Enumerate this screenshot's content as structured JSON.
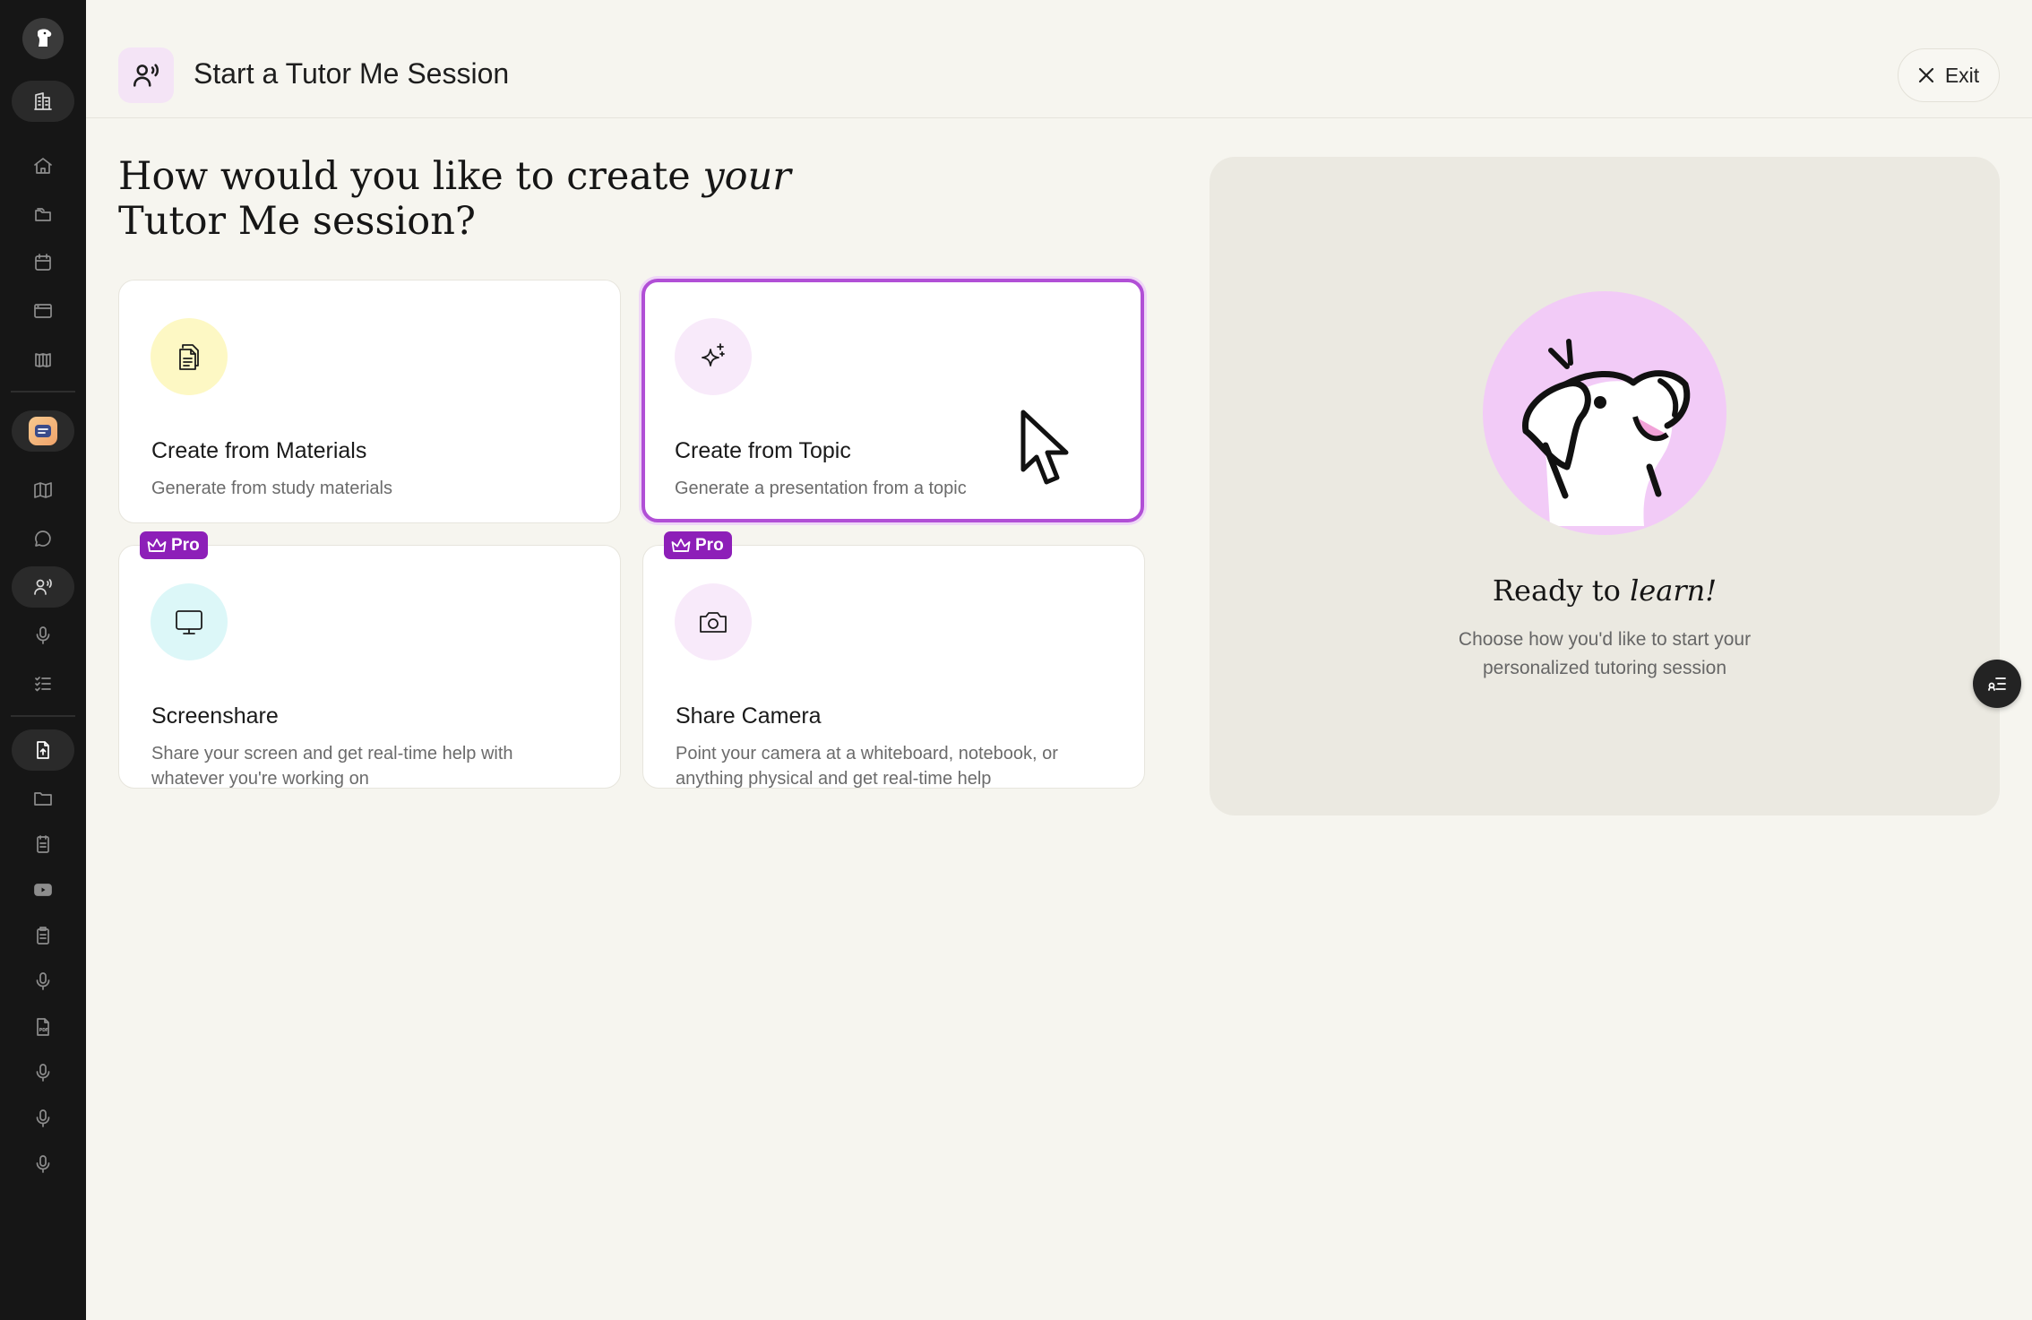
{
  "header": {
    "title": "Start a Tutor Me Session",
    "icon": "tutor-voice-icon",
    "exit_label": "Exit"
  },
  "heading": {
    "prefix": "How would you like to create ",
    "emphasis": "your",
    "suffix": " Tutor Me session?"
  },
  "options": [
    {
      "title": "Create from Materials",
      "description": "Generate from study materials",
      "icon": "documents-icon",
      "icon_bg": "#fdf8c4",
      "pro": false,
      "selected": false
    },
    {
      "title": "Create from Topic",
      "description": "Generate a presentation from a topic",
      "icon": "sparkles-icon",
      "icon_bg": "#f8eafa",
      "pro": false,
      "selected": true
    },
    {
      "title": "Screenshare",
      "description": "Share your screen and get real-time help with whatever you're working on",
      "icon": "monitor-icon",
      "icon_bg": "#dcf7f8",
      "pro": true,
      "selected": false
    },
    {
      "title": "Share Camera",
      "description": "Point your camera at a whiteboard, notebook, or anything physical and get real-time help",
      "icon": "camera-icon",
      "icon_bg": "#f8eafa",
      "pro": true,
      "selected": false
    }
  ],
  "pro_badge": "Pro",
  "panel": {
    "title_prefix": "Ready to ",
    "title_emphasis": "learn!",
    "subtitle": "Choose how you'd like to start your personalized tutoring session"
  },
  "colors": {
    "accent": "#b14fd6",
    "pro_badge": "#8d1fb8",
    "sidebar_bg": "#161616",
    "page_bg": "#f6f5ef",
    "panel_bg": "#ebe9e1",
    "mascot_bg": "#f2cbf7"
  },
  "sidebar": {
    "items": [
      {
        "icon": "building-icon",
        "active": true
      },
      {
        "icon": "home-icon",
        "active": false
      },
      {
        "icon": "folders-icon",
        "active": false
      },
      {
        "icon": "calendar-icon",
        "active": false
      },
      {
        "icon": "browser-window-icon",
        "active": false
      },
      {
        "icon": "library-icon",
        "active": false
      },
      {
        "icon": "app-badge-icon",
        "active": true
      },
      {
        "icon": "map-icon",
        "active": false
      },
      {
        "icon": "chat-bubble-icon",
        "active": false
      },
      {
        "icon": "tutor-voice-icon",
        "active": true
      },
      {
        "icon": "microphone-icon",
        "active": false
      },
      {
        "icon": "checklist-icon",
        "active": false
      },
      {
        "icon": "file-upload-icon",
        "active": true
      },
      {
        "icon": "folder-icon",
        "active": false
      },
      {
        "icon": "notes-icon",
        "active": false
      },
      {
        "icon": "youtube-icon",
        "active": false
      },
      {
        "icon": "clipboard-icon",
        "active": false
      },
      {
        "icon": "microphone-icon",
        "active": false
      },
      {
        "icon": "pdf-file-icon",
        "active": false
      },
      {
        "icon": "microphone-icon",
        "active": false
      },
      {
        "icon": "microphone-icon",
        "active": false
      },
      {
        "icon": "microphone-icon",
        "active": false
      }
    ]
  }
}
